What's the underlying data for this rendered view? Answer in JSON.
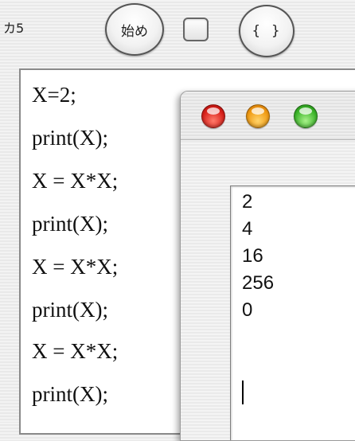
{
  "toolbar": {
    "label": "カ5",
    "start_button": "始め",
    "checkbox_checked": false,
    "brace_button": "{ }"
  },
  "editor": {
    "lines": [
      "X=2;",
      "print(X);",
      "X = X*X;",
      "print(X);",
      "X = X*X;",
      "print(X);",
      "X = X*X;",
      "print(X);"
    ]
  },
  "output_window": {
    "buttons": [
      "close-icon",
      "minimize-icon",
      "zoom-icon"
    ],
    "colors": {
      "close": "#d8201a",
      "minimize": "#f09a12",
      "zoom": "#3cb52a"
    },
    "lines": [
      "2",
      "4",
      "16",
      "256",
      "0"
    ]
  }
}
